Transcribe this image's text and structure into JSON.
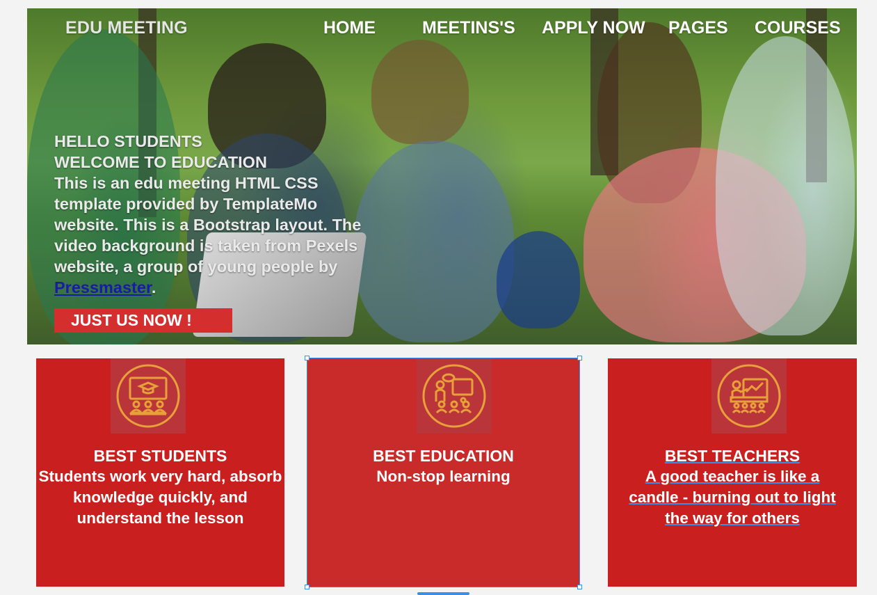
{
  "nav": {
    "brand": "EDU MEETING",
    "items": [
      "HOME",
      "MEETINS'S",
      "APPLY NOW",
      "PAGES",
      "COURSES"
    ]
  },
  "hero": {
    "line1": "HELLO STUDENTS",
    "line2": "WELCOME TO EDUCATION",
    "body": "This is an edu meeting HTML CSS template provided by TemplateMo website. This is a Bootstrap layout. The video background is taken from Pexels website, a group of young people by ",
    "link_text": "Pressmaster",
    "period": ".",
    "cta": "JUST US NOW !"
  },
  "cards": [
    {
      "title": "BEST STUDENTS",
      "desc": "Students work very hard, absorb knowledge quickly, and understand the lesson",
      "icon": "graduation-classroom-icon"
    },
    {
      "title": "BEST EDUCATION",
      "desc": "Non-stop learning",
      "icon": "teacher-board-icon"
    },
    {
      "title": "BEST TEACHERS",
      "desc": "A good teacher is like a candle - burning out to light the way for others",
      "icon": "presentation-icon"
    }
  ],
  "colors": {
    "card_red": "#c91f1f",
    "cta_red": "#d42e2e",
    "icon_orange": "#e8a13a",
    "selection_blue": "#3b8ee8"
  }
}
